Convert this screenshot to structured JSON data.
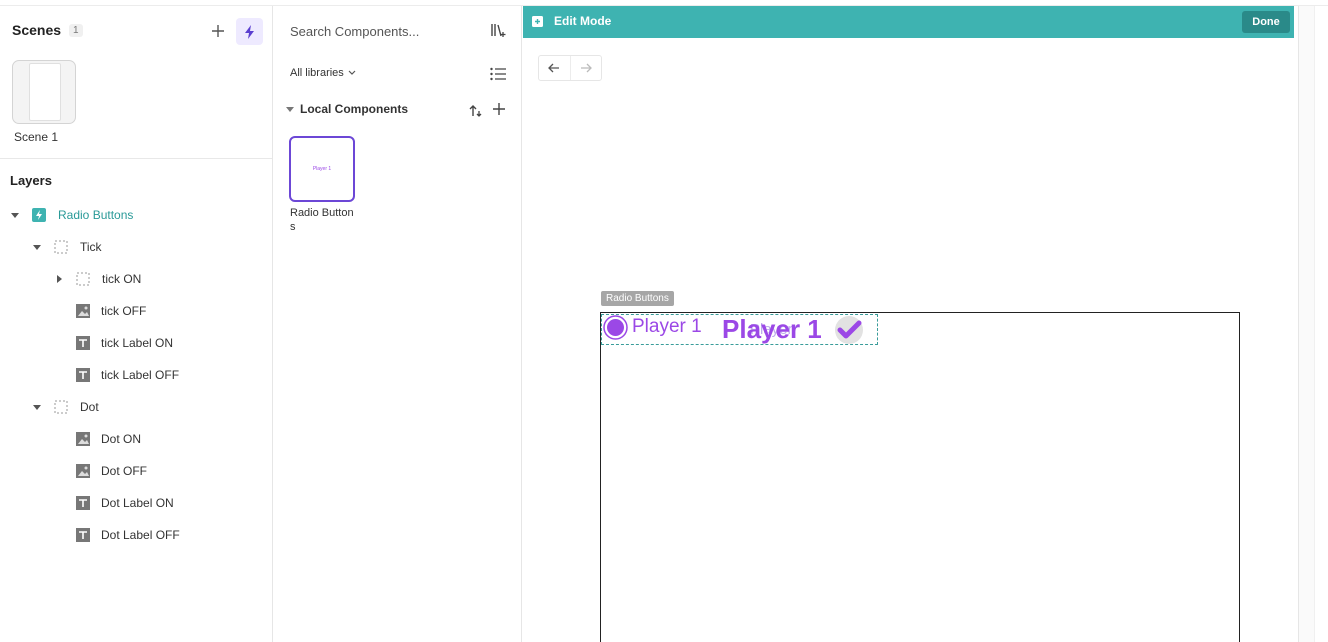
{
  "scenes": {
    "title": "Scenes",
    "count": "1",
    "items": [
      {
        "name": "Scene 1"
      }
    ]
  },
  "layers": {
    "title": "Layers",
    "items": [
      {
        "label": "Radio Buttons",
        "icon": "component-icon",
        "caret": "down"
      },
      {
        "label": "Tick",
        "icon": "frame-icon",
        "caret": "down"
      },
      {
        "label": "tick ON",
        "icon": "frame-icon",
        "caret": "right"
      },
      {
        "label": "tick OFF",
        "icon": "image-icon",
        "caret": ""
      },
      {
        "label": "tick Label ON",
        "icon": "text-icon",
        "caret": ""
      },
      {
        "label": "tick Label OFF",
        "icon": "text-icon",
        "caret": ""
      },
      {
        "label": "Dot",
        "icon": "frame-icon",
        "caret": "down"
      },
      {
        "label": "Dot ON",
        "icon": "image-icon",
        "caret": ""
      },
      {
        "label": "Dot OFF",
        "icon": "image-icon",
        "caret": ""
      },
      {
        "label": "Dot Label ON",
        "icon": "text-icon",
        "caret": ""
      },
      {
        "label": "Dot Label OFF",
        "icon": "text-icon",
        "caret": ""
      }
    ]
  },
  "components": {
    "search_placeholder": "Search Components...",
    "library_filter": "All libraries",
    "section_title": "Local Components",
    "items": [
      {
        "name": "Radio Buttons",
        "thumb_text": "Player 1"
      }
    ]
  },
  "canvas": {
    "mode_title": "Edit Mode",
    "done_label": "Done",
    "component_tag": "Radio Buttons",
    "label_small": "Player 1",
    "label_big": "Player 1",
    "label_ghost": "Player"
  },
  "colors": {
    "accent": "#3eb3b1",
    "done": "#2a8a89",
    "purple": "#9b48e6",
    "selection": "#6c47d6"
  }
}
